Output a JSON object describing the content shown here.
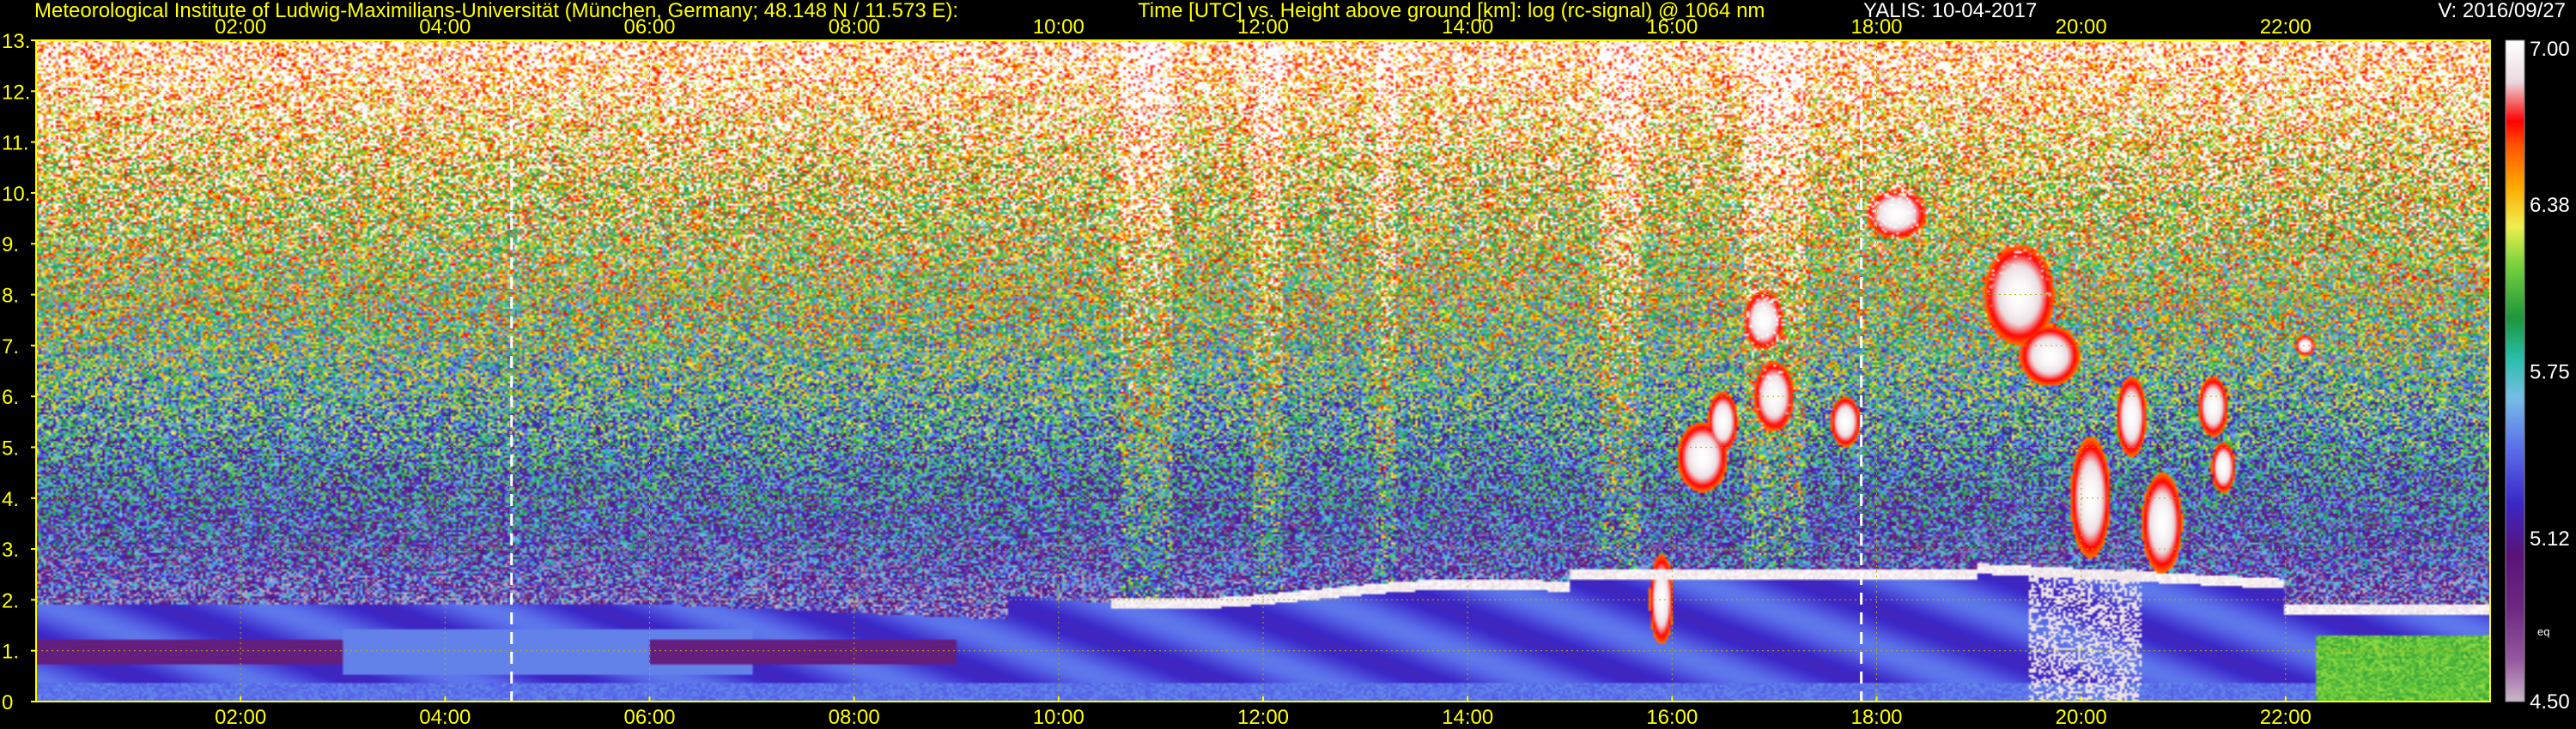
{
  "header": {
    "institute": "Meteorological Institute of Ludwig-Maximilians-Universität (München, Germany; 48.148 N / 11.573 E):",
    "description": "Time [UTC] vs. Height above ground [km]: log (rc-signal) @ 1064 nm",
    "instrument_date": "YALIS: 10-04-2017",
    "version": "V: 2016/09/27"
  },
  "chart_data": {
    "type": "heatmap",
    "x_ticks": [
      "02:00",
      "04:00",
      "06:00",
      "08:00",
      "10:00",
      "12:00",
      "14:00",
      "16:00",
      "18:00",
      "20:00",
      "22:00"
    ],
    "x_tick_hours": [
      2,
      4,
      6,
      8,
      10,
      12,
      14,
      16,
      18,
      20,
      22
    ],
    "xlim_hours": [
      0,
      24
    ],
    "y_ticks": [
      "0",
      "1.",
      "2.",
      "3.",
      "4.",
      "5.",
      "6.",
      "7.",
      "8.",
      "9.",
      "10.",
      "11.",
      "12.",
      "13."
    ],
    "ylim_km": [
      0,
      13
    ],
    "grid": true,
    "colorbar": {
      "labels": [
        "7.00",
        "6.38",
        "5.75",
        "5.12",
        "4.50"
      ],
      "label_values": [
        7.0,
        6.38,
        5.75,
        5.12,
        4.5
      ],
      "range": [
        4.5,
        7.0
      ],
      "extra_label": "eq"
    },
    "dashed_markers_hours": [
      4.65,
      17.85
    ],
    "colors": {
      "text": "#ffff00",
      "grid": "#b0b000",
      "background": "#000000"
    }
  }
}
